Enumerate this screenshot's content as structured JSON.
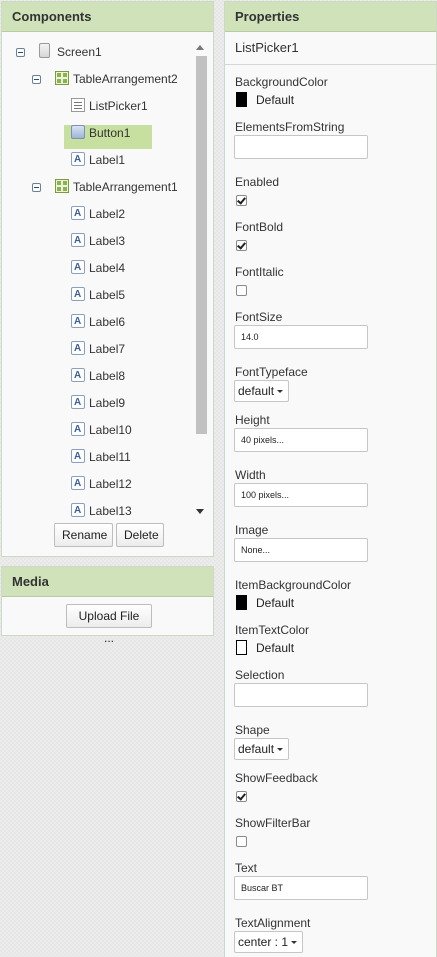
{
  "components": {
    "title": "Components",
    "tree": [
      {
        "label": "Screen1",
        "type": "screen"
      },
      {
        "label": "TableArrangement2",
        "type": "table"
      },
      {
        "label": "ListPicker1",
        "type": "list",
        "selected": true
      },
      {
        "label": "Button1",
        "type": "button"
      },
      {
        "label": "Label1",
        "type": "label"
      },
      {
        "label": "TableArrangement1",
        "type": "table"
      },
      {
        "label": "Label2",
        "type": "label"
      },
      {
        "label": "Label3",
        "type": "label"
      },
      {
        "label": "Label4",
        "type": "label"
      },
      {
        "label": "Label5",
        "type": "label"
      },
      {
        "label": "Label6",
        "type": "label"
      },
      {
        "label": "Label7",
        "type": "label"
      },
      {
        "label": "Label8",
        "type": "label"
      },
      {
        "label": "Label9",
        "type": "label"
      },
      {
        "label": "Label10",
        "type": "label"
      },
      {
        "label": "Label11",
        "type": "label"
      },
      {
        "label": "Label12",
        "type": "label"
      },
      {
        "label": "Label13",
        "type": "label"
      }
    ],
    "rename_label": "Rename",
    "delete_label": "Delete"
  },
  "media": {
    "title": "Media",
    "upload_label": "Upload File ..."
  },
  "properties": {
    "title": "Properties",
    "component_name": "ListPicker1",
    "background_color": {
      "label": "BackgroundColor",
      "value": "Default",
      "swatch": "#000000"
    },
    "elements_from_string": {
      "label": "ElementsFromString",
      "value": ""
    },
    "enabled": {
      "label": "Enabled",
      "checked": true
    },
    "font_bold": {
      "label": "FontBold",
      "checked": true
    },
    "font_italic": {
      "label": "FontItalic",
      "checked": false
    },
    "font_size": {
      "label": "FontSize",
      "value": "14.0"
    },
    "font_typeface": {
      "label": "FontTypeface",
      "value": "default"
    },
    "height": {
      "label": "Height",
      "value": "40 pixels..."
    },
    "width": {
      "label": "Width",
      "value": "100 pixels..."
    },
    "image": {
      "label": "Image",
      "value": "None..."
    },
    "item_background_color": {
      "label": "ItemBackgroundColor",
      "value": "Default",
      "swatch": "#000000"
    },
    "item_text_color": {
      "label": "ItemTextColor",
      "value": "Default",
      "swatch": "#ffffff"
    },
    "selection": {
      "label": "Selection",
      "value": ""
    },
    "shape": {
      "label": "Shape",
      "value": "default"
    },
    "show_feedback": {
      "label": "ShowFeedback",
      "checked": true
    },
    "show_filter_bar": {
      "label": "ShowFilterBar",
      "checked": false
    },
    "text": {
      "label": "Text",
      "value": "Buscar BT"
    },
    "text_alignment": {
      "label": "TextAlignment",
      "value": "center : 1"
    }
  },
  "colors": {
    "header_bg": "#cfe2b9",
    "selected_bg": "#c7df9f"
  }
}
